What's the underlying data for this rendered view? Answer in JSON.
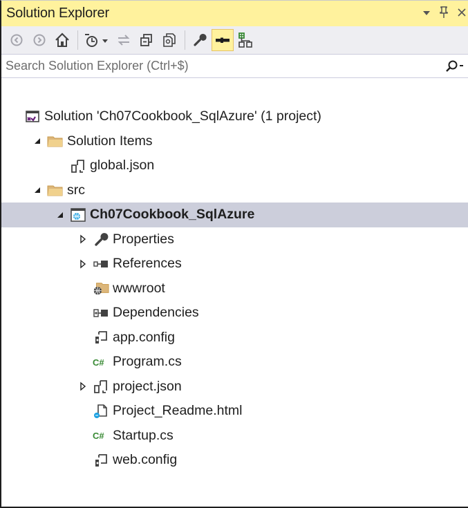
{
  "window": {
    "title": "Solution Explorer",
    "controls": {
      "dropdown": "▾",
      "pin": "Θ",
      "close": "×"
    }
  },
  "toolbar": {
    "buttons": [
      {
        "name": "back-icon"
      },
      {
        "name": "forward-icon"
      },
      {
        "name": "home-icon"
      },
      {
        "name": "pending-changes-filter-icon"
      },
      {
        "name": "sync-active-document-icon"
      },
      {
        "name": "collapse-all-icon"
      },
      {
        "name": "show-all-files-icon"
      },
      {
        "name": "properties-wrench-icon"
      },
      {
        "name": "preview-selected-items-icon",
        "active": true
      },
      {
        "name": "class-view-icon"
      }
    ]
  },
  "search": {
    "placeholder": "Search Solution Explorer (Ctrl+$)"
  },
  "tree": [
    {
      "label": "Solution 'Ch07Cookbook_SqlAzure' (1 project)",
      "icon": "solution-icon",
      "level": 0,
      "expander": "none"
    },
    {
      "label": "Solution Items",
      "icon": "folder-icon",
      "level": 1,
      "expander": "expanded"
    },
    {
      "label": "global.json",
      "icon": "json-file-icon",
      "level": 2,
      "expander": "none"
    },
    {
      "label": "src",
      "icon": "folder-icon",
      "level": 1,
      "expander": "expanded"
    },
    {
      "label": "Ch07Cookbook_SqlAzure",
      "icon": "web-project-icon",
      "level": 2,
      "expander": "expanded",
      "selected": true
    },
    {
      "label": "Properties",
      "icon": "wrench-icon",
      "level": 3,
      "expander": "collapsed"
    },
    {
      "label": "References",
      "icon": "references-icon",
      "level": 3,
      "expander": "collapsed"
    },
    {
      "label": "wwwroot",
      "icon": "web-folder-icon",
      "level": 3,
      "expander": "none"
    },
    {
      "label": "Dependencies",
      "icon": "dependencies-icon",
      "level": 3,
      "expander": "none"
    },
    {
      "label": "app.config",
      "icon": "config-file-icon",
      "level": 3,
      "expander": "none"
    },
    {
      "label": "Program.cs",
      "icon": "csharp-file-icon",
      "level": 3,
      "expander": "none"
    },
    {
      "label": "project.json",
      "icon": "json-file-icon",
      "level": 3,
      "expander": "collapsed"
    },
    {
      "label": "Project_Readme.html",
      "icon": "html-file-icon",
      "level": 3,
      "expander": "none"
    },
    {
      "label": "Startup.cs",
      "icon": "csharp-file-icon",
      "level": 3,
      "expander": "none"
    },
    {
      "label": "web.config",
      "icon": "config-file-icon",
      "level": 3,
      "expander": "none"
    }
  ],
  "colors": {
    "title_background": "#fff29d",
    "toolbar_background": "#eeeef2",
    "selection_background": "#cccedb",
    "text": "#1e1e1e"
  }
}
